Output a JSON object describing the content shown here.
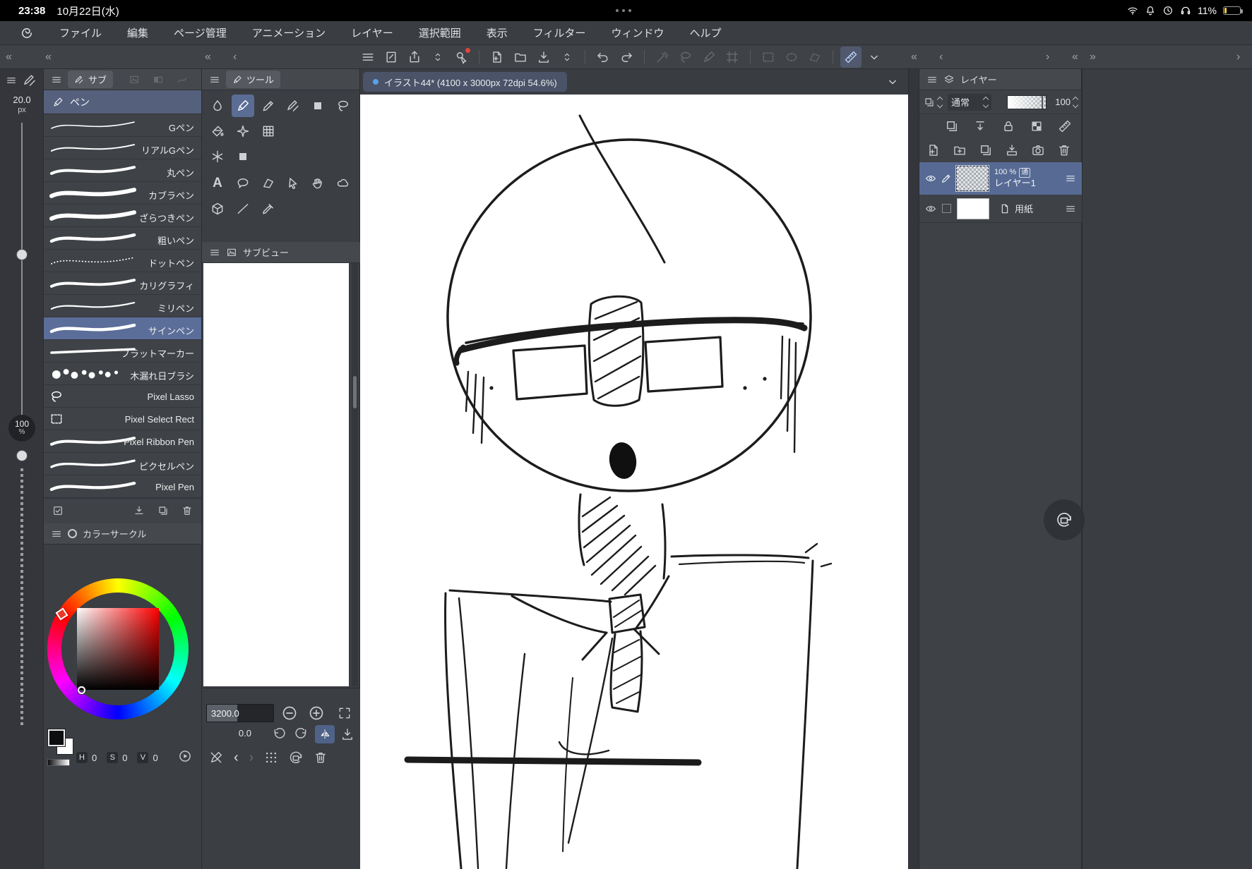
{
  "colors": {
    "selection_blue": "#5b6d99",
    "tab_blue": "#4a5367",
    "tab_dot_blue": "#5aa0e8",
    "battery_low_yellow": "#f6cf4b",
    "panel_dark": "#3b3e43",
    "canvas_white": "#ffffff"
  },
  "glyphs": {
    "collapse_left": "«",
    "collapse_right": "»",
    "chevron_left": "‹",
    "chevron_right": "›"
  },
  "status_bar": {
    "time": "23:38",
    "date": "10月22日(水)",
    "battery_percent": "11%"
  },
  "menu_bar": {
    "items": [
      {
        "label": "ファイル"
      },
      {
        "label": "編集"
      },
      {
        "label": "ページ管理"
      },
      {
        "label": "アニメーション"
      },
      {
        "label": "レイヤー"
      },
      {
        "label": "選択範囲"
      },
      {
        "label": "表示"
      },
      {
        "label": "フィルター"
      },
      {
        "label": "ウィンドウ"
      },
      {
        "label": "ヘルプ"
      }
    ]
  },
  "document": {
    "tab_title": "イラスト44* (4100 x 3000px 72dpi 54.6%)"
  },
  "tool_strip": {
    "brush_size": "20.0",
    "brush_size_unit": "px",
    "opacity": "100",
    "opacity_unit": "%"
  },
  "subtool_panel": {
    "tab_label": "サブ",
    "group_label": "ペン",
    "selected_brush": "サインペン",
    "brushes": [
      {
        "label": "Gペン"
      },
      {
        "label": "リアルGペン"
      },
      {
        "label": "丸ペン"
      },
      {
        "label": "カブラペン"
      },
      {
        "label": "ざらつきペン"
      },
      {
        "label": "粗いペン"
      },
      {
        "label": "ドットペン"
      },
      {
        "label": "カリグラフィ"
      },
      {
        "label": "ミリペン"
      },
      {
        "label": "サインペン"
      },
      {
        "label": "フラットマーカー"
      },
      {
        "label": "木漏れ日ブラシ"
      },
      {
        "label": "Pixel Lasso"
      },
      {
        "label": "Pixel Select Rect"
      },
      {
        "label": "Pixel Ribbon Pen"
      },
      {
        "label": "ピクセルペン"
      },
      {
        "label": "Pixel Pen"
      }
    ]
  },
  "tool_panel": {
    "tab_label": "ツール",
    "text_tool_glyph": "A"
  },
  "subview_panel": {
    "title": "サブビュー"
  },
  "navigator": {
    "zoom_value": "3200.0",
    "rotation_value": "0.0"
  },
  "color_panel": {
    "title": "カラーサークル",
    "h_label": "H",
    "h_value": "0",
    "s_label": "S",
    "s_value": "0",
    "v_label": "V",
    "v_value": "0"
  },
  "layer_panel": {
    "title": "レイヤー",
    "blend_mode": "通常",
    "opacity_value": "100",
    "layers": [
      {
        "opacity_text": "100 %",
        "blend_chip": "通",
        "name": "レイヤー1"
      },
      {
        "name": "用紙"
      }
    ]
  }
}
